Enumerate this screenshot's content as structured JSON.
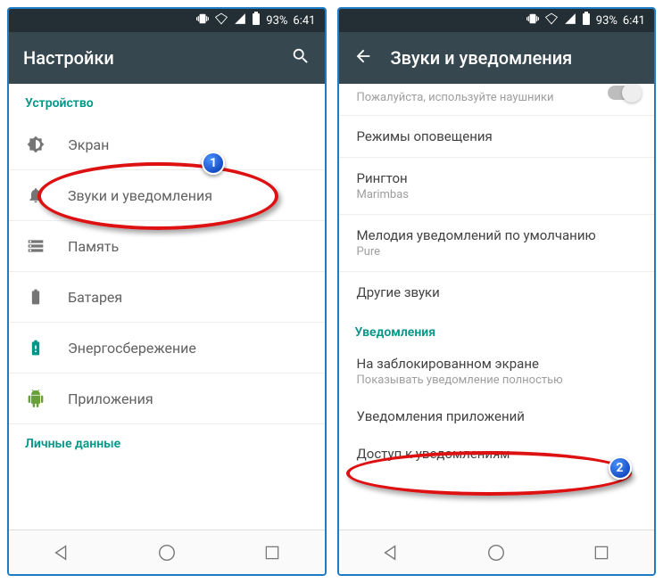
{
  "status": {
    "battery": "93%",
    "time": "6:41"
  },
  "left": {
    "title": "Настройки",
    "section1": "Устройство",
    "items": [
      {
        "label": "Экран"
      },
      {
        "label": "Звуки и уведомления"
      },
      {
        "label": "Память"
      },
      {
        "label": "Батарея"
      },
      {
        "label": "Энергосбережение"
      },
      {
        "label": "Приложения"
      }
    ],
    "section2": "Личные данные",
    "badge": "1"
  },
  "right": {
    "title": "Звуки и уведомления",
    "cutoff_sub": "Пожалуйста, используйте наушники",
    "items": [
      {
        "label": "Режимы оповещения"
      },
      {
        "label": "Рингтон",
        "sub": "Marimbas"
      },
      {
        "label": "Мелодия уведомлений по умолчанию",
        "sub": "Pure"
      },
      {
        "label": "Другие звуки"
      }
    ],
    "section": "Уведомления",
    "items2": [
      {
        "label": "На заблокированном экране",
        "sub": "Показывать уведомление полностью"
      },
      {
        "label": "Уведомления приложений"
      },
      {
        "label": "Доступ к уведомлениям"
      }
    ],
    "badge": "2"
  }
}
